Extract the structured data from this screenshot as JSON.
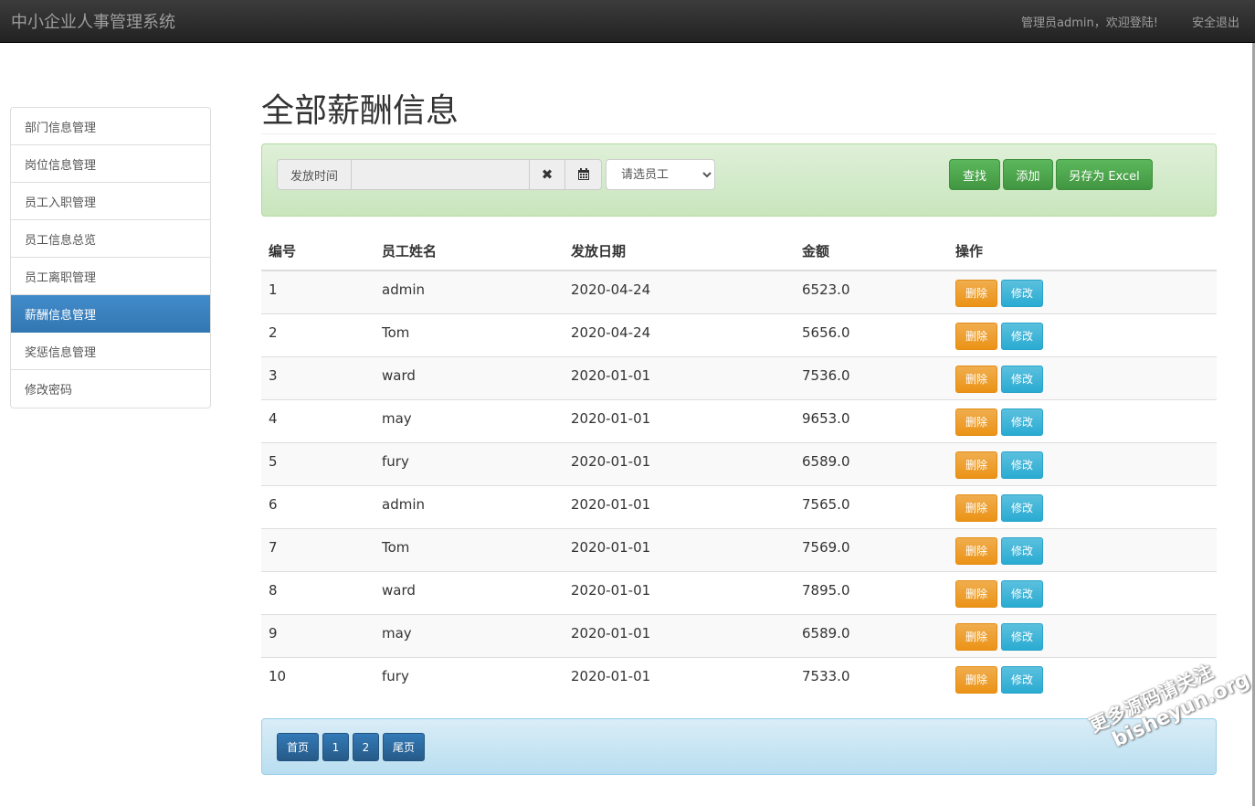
{
  "navbar": {
    "brand": "中小企业人事管理系统",
    "welcome": "管理员admin，欢迎登陆!",
    "logout": "安全退出"
  },
  "sidebar": {
    "items": [
      {
        "label": "部门信息管理"
      },
      {
        "label": "岗位信息管理"
      },
      {
        "label": "员工入职管理"
      },
      {
        "label": "员工信息总览"
      },
      {
        "label": "员工离职管理"
      },
      {
        "label": "薪酬信息管理",
        "active": true
      },
      {
        "label": "奖惩信息管理"
      },
      {
        "label": "修改密码"
      }
    ]
  },
  "page": {
    "title": "全部薪酬信息"
  },
  "search": {
    "date_label": "发放时间",
    "date_value": "",
    "clear_icon": "✖",
    "calendar_icon": "calendar-icon",
    "employee_select": "请选员工",
    "find_label": "查找",
    "add_label": "添加",
    "export_label": "另存为 Excel"
  },
  "table": {
    "headers": [
      "编号",
      "员工姓名",
      "发放日期",
      "金额",
      "操作"
    ],
    "delete_label": "删除",
    "edit_label": "修改",
    "rows": [
      {
        "id": "1",
        "name": "admin",
        "date": "2020-04-24",
        "amount": "6523.0"
      },
      {
        "id": "2",
        "name": "Tom",
        "date": "2020-04-24",
        "amount": "5656.0"
      },
      {
        "id": "3",
        "name": "ward",
        "date": "2020-01-01",
        "amount": "7536.0"
      },
      {
        "id": "4",
        "name": "may",
        "date": "2020-01-01",
        "amount": "9653.0"
      },
      {
        "id": "5",
        "name": "fury",
        "date": "2020-01-01",
        "amount": "6589.0"
      },
      {
        "id": "6",
        "name": "admin",
        "date": "2020-01-01",
        "amount": "7565.0"
      },
      {
        "id": "7",
        "name": "Tom",
        "date": "2020-01-01",
        "amount": "7569.0"
      },
      {
        "id": "8",
        "name": "ward",
        "date": "2020-01-01",
        "amount": "7895.0"
      },
      {
        "id": "9",
        "name": "may",
        "date": "2020-01-01",
        "amount": "6589.0"
      },
      {
        "id": "10",
        "name": "fury",
        "date": "2020-01-01",
        "amount": "7533.0"
      }
    ]
  },
  "pagination": {
    "first": "首页",
    "pages": [
      "1",
      "2"
    ],
    "last": "尾页"
  },
  "watermark": {
    "line1": "更多源码请关注",
    "line2": "bisheyun.org"
  }
}
